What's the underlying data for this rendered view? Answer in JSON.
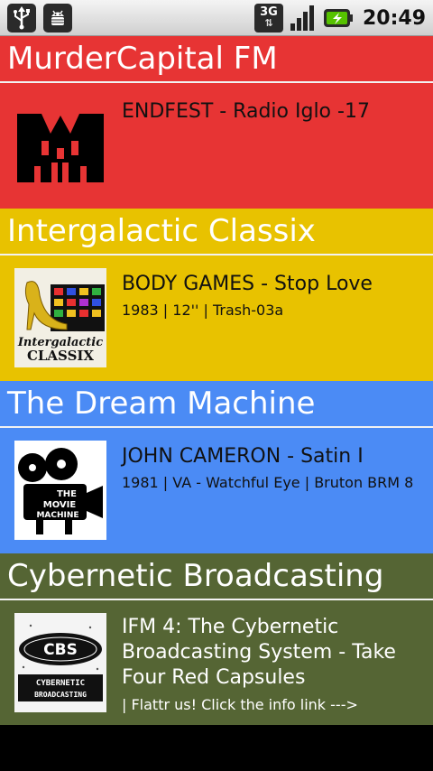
{
  "statusbar": {
    "network_type": "3G",
    "time": "20:49",
    "icons": [
      "usb-icon",
      "android-debug-icon",
      "data-activity-icon",
      "signal-strength-icon",
      "battery-charging-icon"
    ]
  },
  "stations": [
    {
      "name": "MurderCapital FM",
      "color": "#e73434",
      "track_title": "ENDFEST - Radio Iglo -17",
      "track_details": "",
      "logo_icon": "murdercapital-logo-icon"
    },
    {
      "name": "Intergalactic Classix",
      "color": "#e8c200",
      "track_title": "BODY GAMES - Stop Love",
      "track_details": "1983 | 12'' | Trash-03a",
      "logo_icon": "intergalactic-classix-logo-icon",
      "logo_text": [
        "Intergalactic",
        "CLASSIX"
      ]
    },
    {
      "name": "The Dream Machine",
      "color": "#4b8bf5",
      "track_title": "JOHN CAMERON - Satin I",
      "track_details": "1981 | VA - Watchful Eye | Bruton BRM 8",
      "logo_icon": "movie-machine-logo-icon",
      "logo_text": [
        "THE",
        "MOVIE",
        "MACHINE"
      ]
    },
    {
      "name": "Cybernetic Broadcasting",
      "color": "#556534",
      "track_title": "IFM 4: The Cybernetic Broadcasting System - Take Four Red Capsules",
      "track_details": "| Flattr us! Click the info link --->",
      "logo_icon": "cbs-logo-icon",
      "logo_text": [
        "CBS",
        "CYBERNETIC",
        "BROADCASTING"
      ]
    }
  ]
}
